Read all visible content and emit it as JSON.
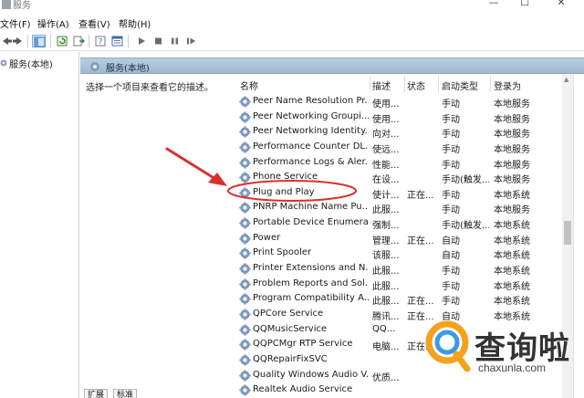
{
  "window": {
    "title": "服务",
    "controls": [
      "—",
      "☐",
      "✕"
    ]
  },
  "menu": [
    "文件(F)",
    "操作(A)",
    "查看(V)",
    "帮助(H)"
  ],
  "toolbar": {
    "icons": [
      "back-arrow-icon",
      "forward-arrow-icon",
      "console-tree-icon",
      "refresh-icon",
      "export-icon",
      "help-icon",
      "properties-icon",
      "play-icon",
      "stop-icon",
      "pause-icon",
      "resume-icon"
    ]
  },
  "tree": {
    "root_label": "服务(本地)"
  },
  "details": {
    "header_title": "服务(本地)",
    "description": "选择一个项目来查看它的描述。"
  },
  "table": {
    "columns": [
      "名称",
      "描述",
      "状态",
      "启动类型",
      "登录为"
    ],
    "rows": [
      {
        "name": "Peer Name Resolution Pr...",
        "desc": "使用...",
        "status": "",
        "startup": "手动",
        "logon": "本地服务"
      },
      {
        "name": "Peer Networking Groupi...",
        "desc": "使用...",
        "status": "",
        "startup": "手动",
        "logon": "本地服务"
      },
      {
        "name": "Peer Networking Identity...",
        "desc": "向对...",
        "status": "",
        "startup": "手动",
        "logon": "本地服务"
      },
      {
        "name": "Performance Counter DL...",
        "desc": "使远...",
        "status": "",
        "startup": "手动",
        "logon": "本地服务"
      },
      {
        "name": "Performance Logs & Aler...",
        "desc": "性能...",
        "status": "",
        "startup": "手动",
        "logon": "本地服务"
      },
      {
        "name": "Phone Service",
        "desc": "在设...",
        "status": "",
        "startup": "手动(触发...",
        "logon": "本地服务"
      },
      {
        "name": "Plug and Play",
        "desc": "使计...",
        "status": "正在...",
        "startup": "手动",
        "logon": "本地系统"
      },
      {
        "name": "PNRP Machine Name Pu...",
        "desc": "此服...",
        "status": "",
        "startup": "手动",
        "logon": "本地服务"
      },
      {
        "name": "Portable Device Enumera...",
        "desc": "强制...",
        "status": "",
        "startup": "手动(触发...",
        "logon": "本地系统"
      },
      {
        "name": "Power",
        "desc": "管理...",
        "status": "正在...",
        "startup": "自动",
        "logon": "本地系统"
      },
      {
        "name": "Print Spooler",
        "desc": "该服...",
        "status": "",
        "startup": "自动",
        "logon": "本地系统"
      },
      {
        "name": "Printer Extensions and N...",
        "desc": "此服...",
        "status": "",
        "startup": "手动",
        "logon": "本地系统"
      },
      {
        "name": "Problem Reports and Sol...",
        "desc": "此服...",
        "status": "",
        "startup": "手动",
        "logon": "本地系统"
      },
      {
        "name": "Program Compatibility A...",
        "desc": "此服...",
        "status": "正在...",
        "startup": "手动",
        "logon": "本地系统"
      },
      {
        "name": "QPCore Service",
        "desc": "腾讯...",
        "status": "正在...",
        "startup": "自动",
        "logon": "本地系统"
      },
      {
        "name": "QQMusicService",
        "desc": "QQ...",
        "status": "",
        "startup": "",
        "logon": ""
      },
      {
        "name": "QQPCMgr RTP Service",
        "desc": "电脑...",
        "status": "正在...",
        "startup": "",
        "logon": ""
      },
      {
        "name": "QQRepairFixSVC",
        "desc": "",
        "status": "",
        "startup": "",
        "logon": ""
      },
      {
        "name": "Quality Windows Audio V...",
        "desc": "优质...",
        "status": "",
        "startup": "",
        "logon": ""
      },
      {
        "name": "Realtek Audio Service",
        "desc": "",
        "status": "",
        "startup": "",
        "logon": ""
      }
    ]
  },
  "bottom_tabs": [
    "扩展",
    "标准"
  ],
  "watermark": {
    "text": "查询啦",
    "sub": "chaxunla.com"
  },
  "colors": {
    "header_band": "#a9c1d8",
    "annotation_red": "#d9302c",
    "gear_blue": "#6f8fb5"
  }
}
